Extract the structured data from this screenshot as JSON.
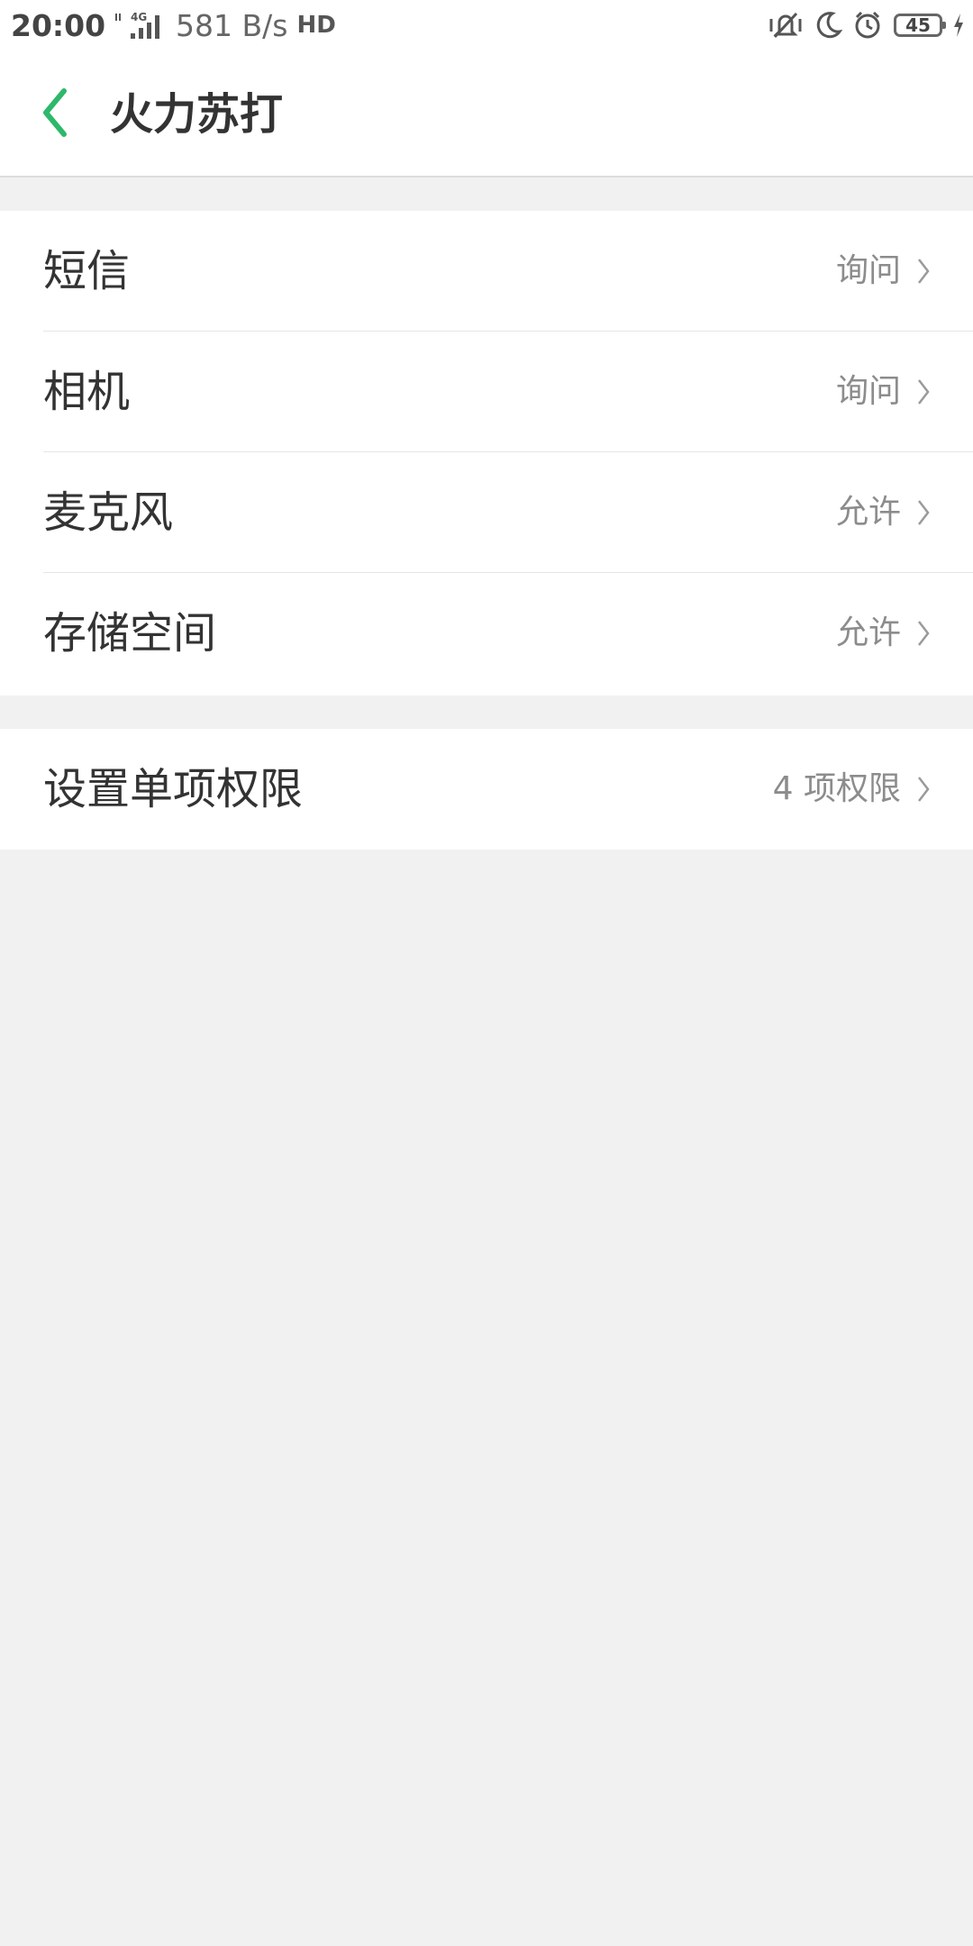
{
  "status_bar": {
    "time": "20:00",
    "network_type": "4G",
    "speed": "581 B/s",
    "hd": "HD",
    "battery": "45"
  },
  "header": {
    "title": "火力苏打"
  },
  "permissions": [
    {
      "label": "短信",
      "value": "询问"
    },
    {
      "label": "相机",
      "value": "询问"
    },
    {
      "label": "麦克风",
      "value": "允许"
    },
    {
      "label": "存储空间",
      "value": "允许"
    }
  ],
  "individual": {
    "label": "设置单项权限",
    "value": "4 项权限"
  },
  "colors": {
    "accent": "#2db86a",
    "background": "#f1f1f1",
    "text_primary": "#333333",
    "text_secondary": "#8c8c8c"
  },
  "icons": [
    "back-arrow-icon",
    "chevron-right-icon",
    "vibrate-icon",
    "moon-icon",
    "alarm-icon",
    "battery-icon",
    "signal-icon"
  ]
}
